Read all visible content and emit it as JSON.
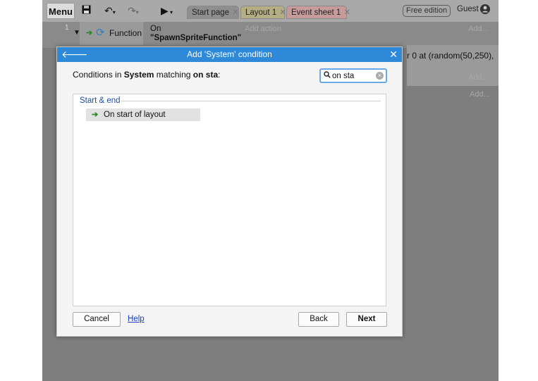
{
  "toolbar": {
    "menu_label": "Menu",
    "tabs": [
      {
        "label": "Start page"
      },
      {
        "label": "Layout 1"
      },
      {
        "label": "Event sheet 1"
      }
    ],
    "tab_close": "✕",
    "edition": "Free edition",
    "user": "Guest"
  },
  "event_sheet": {
    "line_number": "1",
    "function_label": "Function",
    "on_label": "On",
    "function_name": "\"SpawnSpriteFunction\"",
    "add_action": "Add action",
    "add_right": "Add...",
    "partial_text": "r 0 at (random(50,250),"
  },
  "dialog": {
    "title": "Add 'System' condition",
    "prompt_prefix": "Conditions in ",
    "prompt_object": "System",
    "prompt_middle": " matching ",
    "prompt_query": "on sta",
    "prompt_suffix": ":",
    "search_value": "on sta",
    "group_title": "Start & end",
    "item_label": "On start of layout",
    "cancel_label": "Cancel",
    "help_label": "Help",
    "back_label": "Back",
    "next_label": "Next"
  },
  "colors": {
    "title_bar": "#2e8ad8",
    "group_title": "#1e4da0",
    "link": "#1a3fcc"
  }
}
